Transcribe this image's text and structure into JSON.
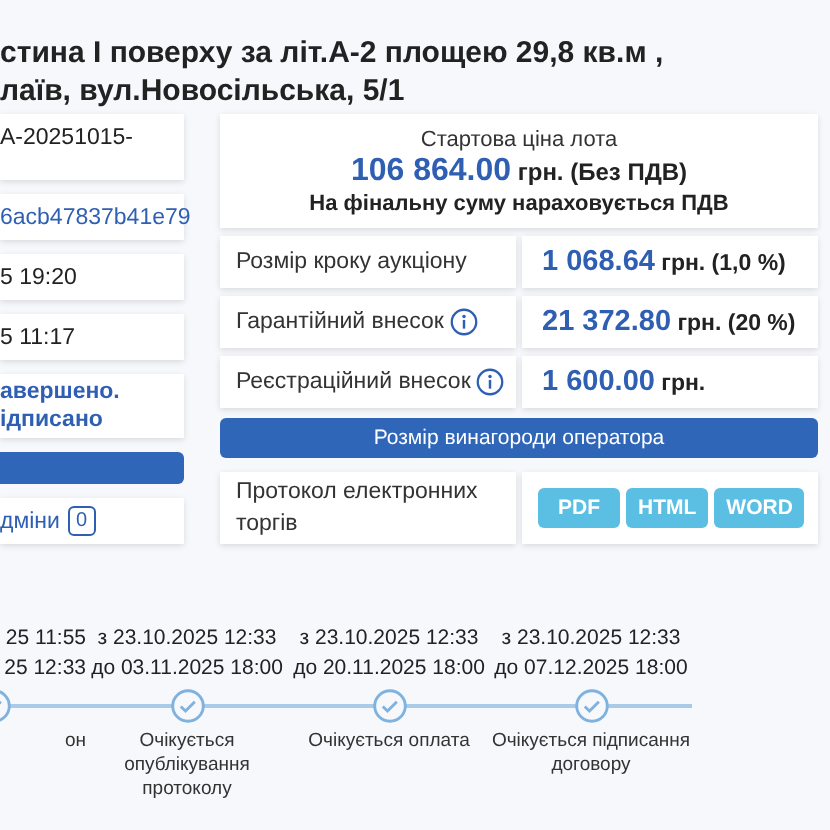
{
  "title": {
    "lines": [
      "стина I поверху за літ.А-2 площею 29,8 кв.м ,",
      "лаїв, вул.Новосільська, 5/1"
    ]
  },
  "left_cards": [
    {
      "kind": "text",
      "lines": [
        "A-20251015-"
      ]
    },
    {
      "kind": "link",
      "lines": [
        "6acb47837b41e79"
      ]
    },
    {
      "kind": "text",
      "lines": [
        "5 19:20"
      ]
    },
    {
      "kind": "text",
      "lines": [
        "5 11:17"
      ]
    },
    {
      "kind": "status",
      "lines": [
        "авершено.",
        "ідписано"
      ]
    },
    {
      "kind": "bar"
    },
    {
      "kind": "changes",
      "lines": [
        "дміни"
      ],
      "count": "0"
    }
  ],
  "start_price": {
    "label": "Стартова ціна лота",
    "amount": "106 864.00",
    "suffix": "грн. (Без ПДВ)",
    "note": "На фінальну суму нараховується ПДВ"
  },
  "rows": [
    {
      "label": "Розмір кроку аукціону",
      "info": false,
      "amount": "1 068.64",
      "suffix": "грн. (1,0 %)"
    },
    {
      "label": "Гарантійний внесок",
      "info": true,
      "amount": "21 372.80",
      "suffix": "грн. (20 %)"
    },
    {
      "label": "Реєстраційний внесок",
      "info": true,
      "amount": "1 600.00",
      "suffix": "грн."
    }
  ],
  "operator_fee_button": "Розмір винагороди оператора",
  "protocol": {
    "label": "Протокол електронних торгів",
    "formats": [
      "PDF",
      "HTML",
      "WORD"
    ]
  },
  "timeline": [
    {
      "dates": [
        "25 11:55",
        "25 12:33"
      ],
      "label": "он"
    },
    {
      "dates": [
        "з 23.10.2025 12:33",
        "до 03.11.2025 18:00"
      ],
      "label": "Очікується опублікування протоколу"
    },
    {
      "dates": [
        "з 23.10.2025 12:33",
        "до 20.11.2025 18:00"
      ],
      "label": "Очікується оплата"
    },
    {
      "dates": [
        "з 23.10.2025 12:33",
        "до 07.12.2025 18:00"
      ],
      "label": "Очікується підписання договору"
    }
  ]
}
